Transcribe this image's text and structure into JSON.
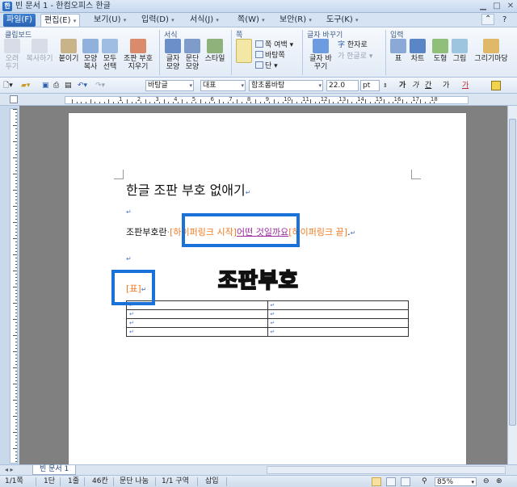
{
  "window": {
    "title": "빈 문서 1 - 한컴오피스 한글"
  },
  "menu": [
    {
      "label": "파일(F)",
      "style": "file"
    },
    {
      "label": "편집(E)",
      "style": "active"
    },
    {
      "label": "보기(U)"
    },
    {
      "label": "입력(D)"
    },
    {
      "label": "서식(J)"
    },
    {
      "label": "쪽(W)"
    },
    {
      "label": "보안(R)"
    },
    {
      "label": "도구(K)"
    }
  ],
  "ribbon": {
    "groups": {
      "clipboard": "클립보드",
      "format": "서식",
      "page": "쪽",
      "find": "글자 바꾸기",
      "insert": "입력"
    },
    "clipboard": [
      "오려 두기",
      "복사하기",
      "붙이기",
      "모양 복사",
      "모두 선택",
      "조판 부호 지우기"
    ],
    "format": [
      "글자 모양",
      "문단 모양",
      "스타일"
    ],
    "page": {
      "margin": "쪽 여백",
      "bg": "바탕쪽",
      "col": "단"
    },
    "find": {
      "replace": "글자 바꾸기",
      "hanja": "한자로",
      "hangul": "한글로"
    },
    "insert": [
      "표",
      "차트",
      "도형",
      "그림",
      "그리기마당"
    ]
  },
  "format_toolbar": {
    "style": "바탕글",
    "font_kind": "대표",
    "font": "함초롬바탕",
    "size": "22.0",
    "unit": "pt",
    "bold": "가",
    "italic": "가",
    "underline": "간",
    "more": "가",
    "color": "가"
  },
  "ruler_numbers": [
    "1",
    "2",
    "3",
    "4",
    "5",
    "6",
    "7",
    "8",
    "9",
    "10",
    "11",
    "12",
    "13",
    "14",
    "15",
    "16",
    "17",
    "18"
  ],
  "document": {
    "heading": "한글 조판 부호 없애기",
    "line2_prefix": "조판부호란",
    "hyperlink_start": "[하이퍼링크 시작]",
    "hyperlink_text": "어떤 것일까요",
    "hyperlink_end": "[하이퍼링크 끝]",
    "line2_suffix": ".",
    "table_marker": "[표]",
    "overlay_title": "조판부호",
    "para_mark": "↵",
    "table_rows": [
      [
        "↵",
        "↵"
      ],
      [
        "↵",
        "↵"
      ],
      [
        "↵",
        "↵"
      ],
      [
        "↵",
        "↵"
      ]
    ]
  },
  "tabs": {
    "doc_tab": "빈 문서 1"
  },
  "status": {
    "page": "1/1쪽",
    "column": "1단",
    "line": "1줄",
    "char": "46칸",
    "break": "문단 나눔",
    "section": "1/1 구역",
    "mode": "삽입",
    "zoom": "85%"
  },
  "colors": {
    "highlight_box": "#1a72d9",
    "hyperlink_marker": "#f07a20",
    "hyperlink_text": "#9b2c9b",
    "para_mark": "#4a78c8"
  }
}
